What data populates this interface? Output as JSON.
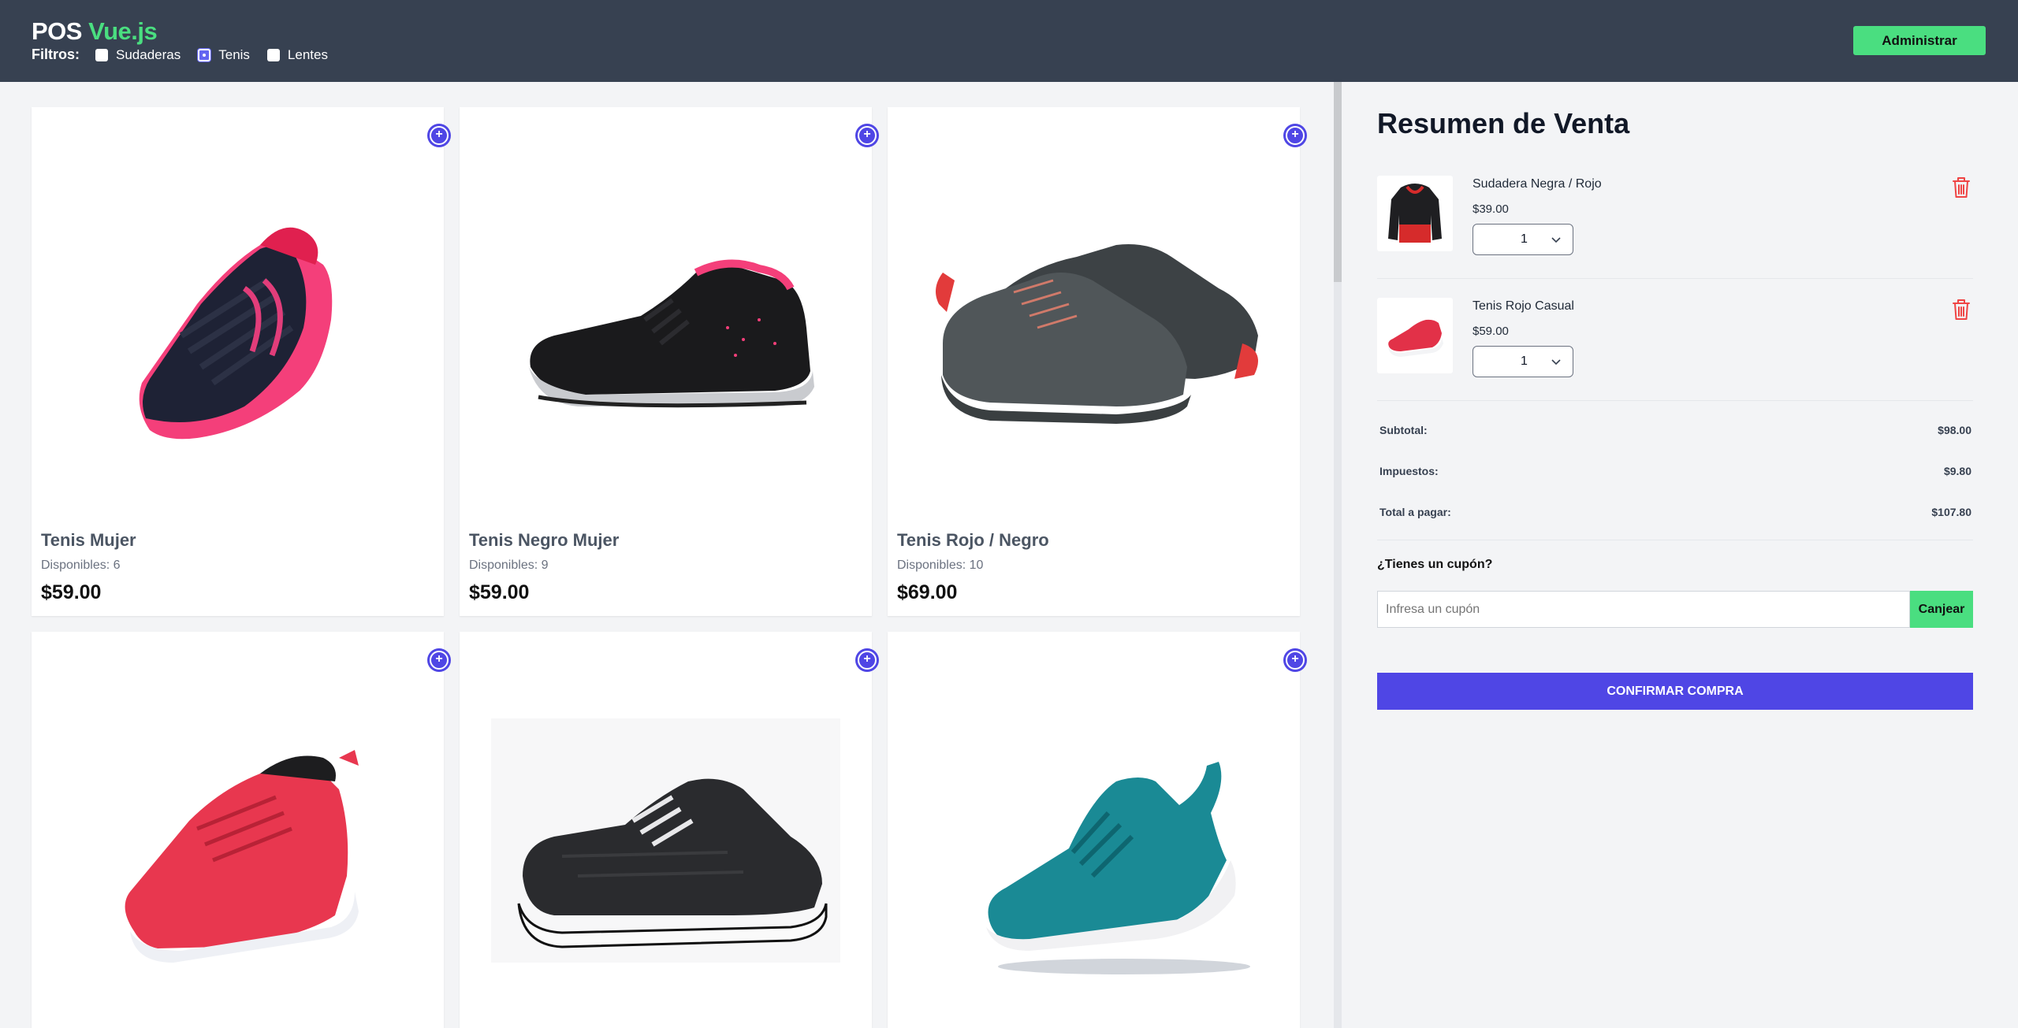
{
  "header": {
    "brand_main": "POS ",
    "brand_accent": "Vue.js",
    "filters_label": "Filtros:",
    "filters": [
      {
        "label": "Sudaderas",
        "checked": false
      },
      {
        "label": "Tenis",
        "checked": true
      },
      {
        "label": "Lentes",
        "checked": false
      }
    ],
    "admin_button": "Administrar"
  },
  "products": [
    {
      "name": "Tenis Mujer",
      "stock": "Disponibles: 6",
      "price": "$59.00",
      "image": "navy-pink-sneaker"
    },
    {
      "name": "Tenis Negro Mujer",
      "stock": "Disponibles: 9",
      "price": "$59.00",
      "image": "black-pink-sneaker"
    },
    {
      "name": "Tenis Rojo / Negro",
      "stock": "Disponibles: 10",
      "price": "$69.00",
      "image": "grey-red-sneakers"
    },
    {
      "name": "",
      "stock": "",
      "price": "",
      "image": "red-sneaker"
    },
    {
      "name": "",
      "stock": "",
      "price": "",
      "image": "black-white-sneaker"
    },
    {
      "name": "",
      "stock": "",
      "price": "",
      "image": "teal-sneaker"
    }
  ],
  "summary": {
    "title": "Resumen de Venta",
    "items": [
      {
        "name": "Sudadera Negra / Rojo",
        "price": "$39.00",
        "quantity": "1",
        "image": "black-red-hoodie"
      },
      {
        "name": "Tenis Rojo Casual",
        "price": "$59.00",
        "quantity": "1",
        "image": "red-sneaker"
      }
    ],
    "subtotal_label": "Subtotal:",
    "subtotal": "$98.00",
    "tax_label": "Impuestos:",
    "tax": "$9.80",
    "total_label": "Total a pagar:",
    "total": "$107.80",
    "coupon_question": "¿Tienes un cupón?",
    "coupon_placeholder": "Infresa un cupón",
    "coupon_button": "Canjear",
    "confirm_button": "CONFIRMAR COMPRA"
  },
  "colors": {
    "header_bg": "#374151",
    "accent_green": "#4ade80",
    "primary_indigo": "#4f46e5",
    "delete_red": "#ef4444"
  }
}
